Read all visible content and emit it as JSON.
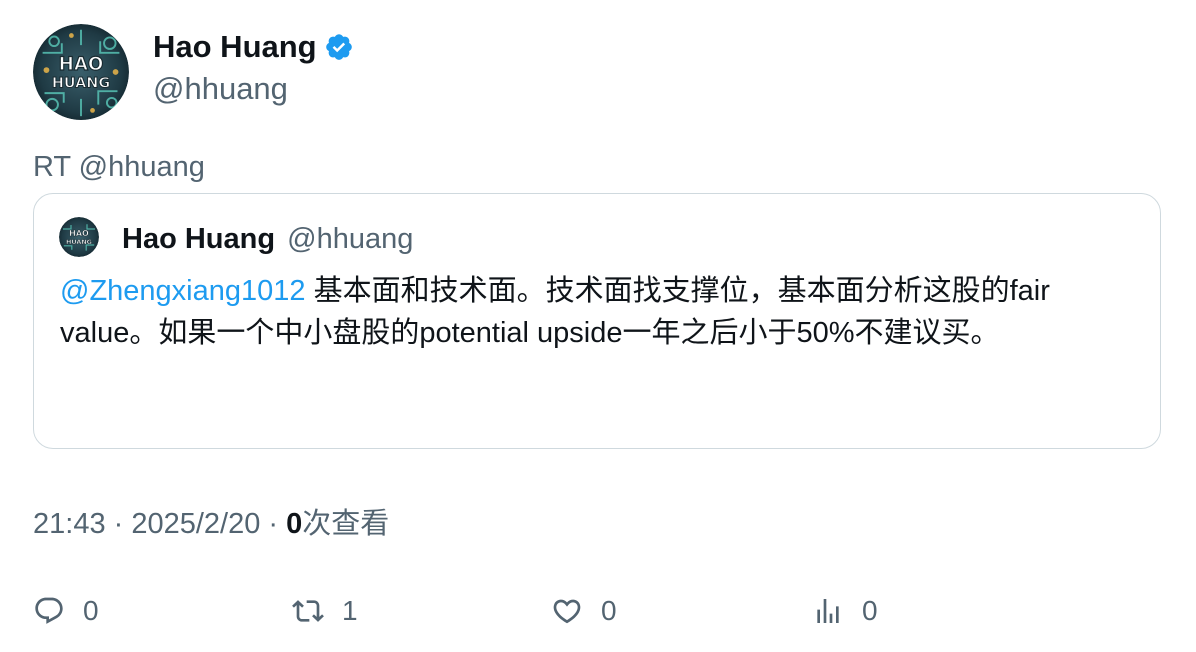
{
  "author": {
    "display_name": "Hao Huang",
    "handle": "@hhuang",
    "verified": true,
    "avatar_icon": "hao-huang-logo-avatar"
  },
  "tweet": {
    "text": "RT @hhuang"
  },
  "quoted_tweet": {
    "display_name": "Hao Huang",
    "handle": "@hhuang",
    "mention": "@Zhengxiang1012",
    "text": " 基本面和技术面。技术面找支撑位，基本面分析这股的fair value。如果一个中小盘股的potential upside一年之后小于50%不建议买。"
  },
  "meta": {
    "time": "21:43",
    "separator": " · ",
    "date": "2025/2/20",
    "views_count": "0",
    "views_label": "次查看"
  },
  "actions": {
    "reply_count": "0",
    "retweet_count": "1",
    "like_count": "0",
    "views_count": "0"
  },
  "colors": {
    "text_primary": "#0f1419",
    "text_secondary": "#536471",
    "link": "#1d9bf0",
    "border": "#cfd9de",
    "verified": "#1d9bf0"
  }
}
